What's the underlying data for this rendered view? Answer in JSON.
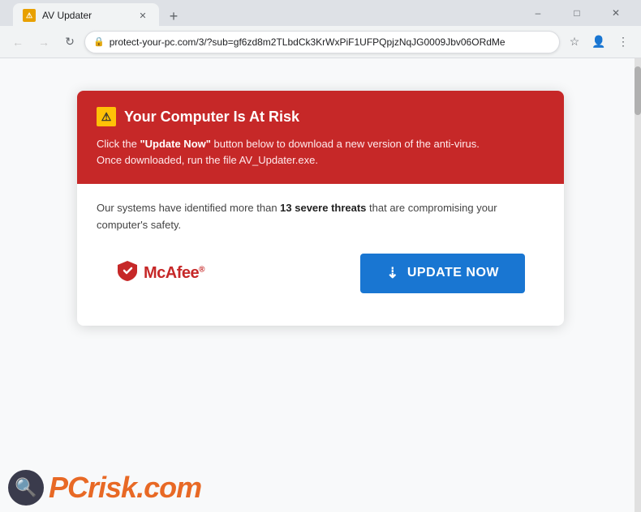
{
  "browser": {
    "tab_title": "AV Updater",
    "url": "protect-your-pc.com/3/?sub=gf6zd8m2TLbdCk3KrWxPiF1UFPQpjzNqJG0009Jbv06ORdMe",
    "new_tab_label": "+",
    "back_tooltip": "Back",
    "forward_tooltip": "Forward",
    "refresh_tooltip": "Refresh",
    "minimize_label": "–",
    "maximize_label": "□",
    "close_label": "✕"
  },
  "page": {
    "alert_title": "Your Computer Is At Risk",
    "alert_body_line1_prefix": "Click the ",
    "alert_body_bold": "\"Update Now\"",
    "alert_body_line1_suffix": " button below to download a new version of the anti-virus.",
    "alert_body_line2": "Once downloaded, run the file AV_Updater.exe.",
    "threat_text_prefix": "Our systems have identified more than ",
    "threat_count": "13 severe threats",
    "threat_text_suffix": " that are compromising your computer's safety.",
    "mcafee_label": "McAfee",
    "update_button_label": "UPDATE NOW"
  },
  "watermark": {
    "pc_text": "PC",
    "risk_text": "risk.com"
  }
}
